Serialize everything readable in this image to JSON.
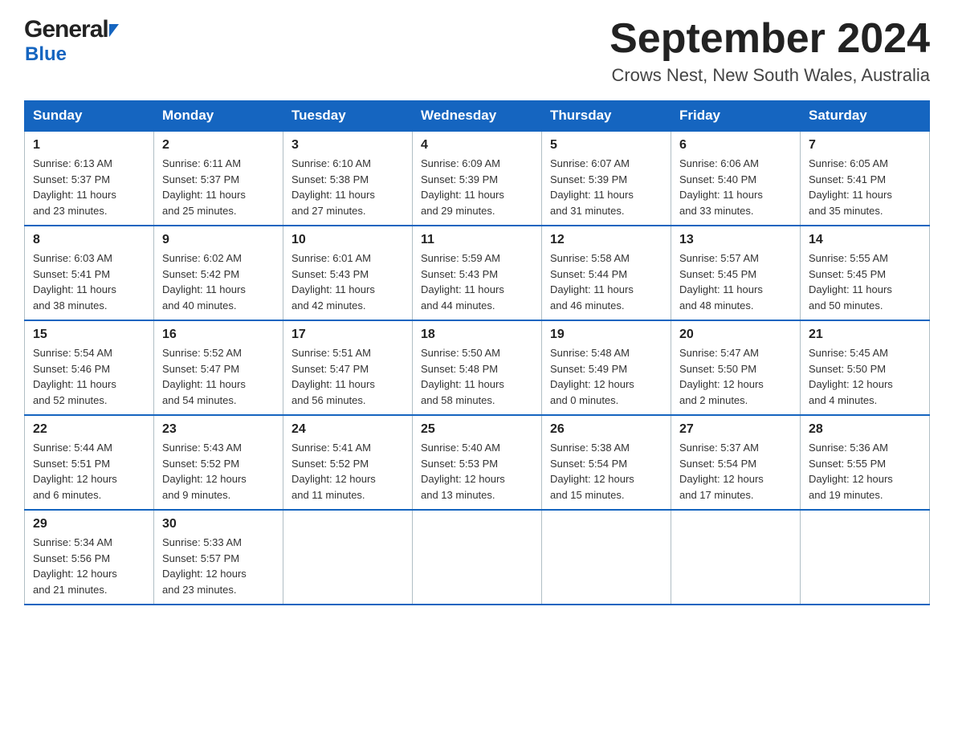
{
  "header": {
    "logo_general": "General",
    "logo_blue": "Blue",
    "month_title": "September 2024",
    "subtitle": "Crows Nest, New South Wales, Australia"
  },
  "weekdays": [
    "Sunday",
    "Monday",
    "Tuesday",
    "Wednesday",
    "Thursday",
    "Friday",
    "Saturday"
  ],
  "weeks": [
    [
      {
        "day": "1",
        "sunrise": "6:13 AM",
        "sunset": "5:37 PM",
        "daylight": "11 hours and 23 minutes."
      },
      {
        "day": "2",
        "sunrise": "6:11 AM",
        "sunset": "5:37 PM",
        "daylight": "11 hours and 25 minutes."
      },
      {
        "day": "3",
        "sunrise": "6:10 AM",
        "sunset": "5:38 PM",
        "daylight": "11 hours and 27 minutes."
      },
      {
        "day": "4",
        "sunrise": "6:09 AM",
        "sunset": "5:39 PM",
        "daylight": "11 hours and 29 minutes."
      },
      {
        "day": "5",
        "sunrise": "6:07 AM",
        "sunset": "5:39 PM",
        "daylight": "11 hours and 31 minutes."
      },
      {
        "day": "6",
        "sunrise": "6:06 AM",
        "sunset": "5:40 PM",
        "daylight": "11 hours and 33 minutes."
      },
      {
        "day": "7",
        "sunrise": "6:05 AM",
        "sunset": "5:41 PM",
        "daylight": "11 hours and 35 minutes."
      }
    ],
    [
      {
        "day": "8",
        "sunrise": "6:03 AM",
        "sunset": "5:41 PM",
        "daylight": "11 hours and 38 minutes."
      },
      {
        "day": "9",
        "sunrise": "6:02 AM",
        "sunset": "5:42 PM",
        "daylight": "11 hours and 40 minutes."
      },
      {
        "day": "10",
        "sunrise": "6:01 AM",
        "sunset": "5:43 PM",
        "daylight": "11 hours and 42 minutes."
      },
      {
        "day": "11",
        "sunrise": "5:59 AM",
        "sunset": "5:43 PM",
        "daylight": "11 hours and 44 minutes."
      },
      {
        "day": "12",
        "sunrise": "5:58 AM",
        "sunset": "5:44 PM",
        "daylight": "11 hours and 46 minutes."
      },
      {
        "day": "13",
        "sunrise": "5:57 AM",
        "sunset": "5:45 PM",
        "daylight": "11 hours and 48 minutes."
      },
      {
        "day": "14",
        "sunrise": "5:55 AM",
        "sunset": "5:45 PM",
        "daylight": "11 hours and 50 minutes."
      }
    ],
    [
      {
        "day": "15",
        "sunrise": "5:54 AM",
        "sunset": "5:46 PM",
        "daylight": "11 hours and 52 minutes."
      },
      {
        "day": "16",
        "sunrise": "5:52 AM",
        "sunset": "5:47 PM",
        "daylight": "11 hours and 54 minutes."
      },
      {
        "day": "17",
        "sunrise": "5:51 AM",
        "sunset": "5:47 PM",
        "daylight": "11 hours and 56 minutes."
      },
      {
        "day": "18",
        "sunrise": "5:50 AM",
        "sunset": "5:48 PM",
        "daylight": "11 hours and 58 minutes."
      },
      {
        "day": "19",
        "sunrise": "5:48 AM",
        "sunset": "5:49 PM",
        "daylight": "12 hours and 0 minutes."
      },
      {
        "day": "20",
        "sunrise": "5:47 AM",
        "sunset": "5:50 PM",
        "daylight": "12 hours and 2 minutes."
      },
      {
        "day": "21",
        "sunrise": "5:45 AM",
        "sunset": "5:50 PM",
        "daylight": "12 hours and 4 minutes."
      }
    ],
    [
      {
        "day": "22",
        "sunrise": "5:44 AM",
        "sunset": "5:51 PM",
        "daylight": "12 hours and 6 minutes."
      },
      {
        "day": "23",
        "sunrise": "5:43 AM",
        "sunset": "5:52 PM",
        "daylight": "12 hours and 9 minutes."
      },
      {
        "day": "24",
        "sunrise": "5:41 AM",
        "sunset": "5:52 PM",
        "daylight": "12 hours and 11 minutes."
      },
      {
        "day": "25",
        "sunrise": "5:40 AM",
        "sunset": "5:53 PM",
        "daylight": "12 hours and 13 minutes."
      },
      {
        "day": "26",
        "sunrise": "5:38 AM",
        "sunset": "5:54 PM",
        "daylight": "12 hours and 15 minutes."
      },
      {
        "day": "27",
        "sunrise": "5:37 AM",
        "sunset": "5:54 PM",
        "daylight": "12 hours and 17 minutes."
      },
      {
        "day": "28",
        "sunrise": "5:36 AM",
        "sunset": "5:55 PM",
        "daylight": "12 hours and 19 minutes."
      }
    ],
    [
      {
        "day": "29",
        "sunrise": "5:34 AM",
        "sunset": "5:56 PM",
        "daylight": "12 hours and 21 minutes."
      },
      {
        "day": "30",
        "sunrise": "5:33 AM",
        "sunset": "5:57 PM",
        "daylight": "12 hours and 23 minutes."
      },
      null,
      null,
      null,
      null,
      null
    ]
  ],
  "labels": {
    "sunrise": "Sunrise:",
    "sunset": "Sunset:",
    "daylight": "Daylight:"
  }
}
